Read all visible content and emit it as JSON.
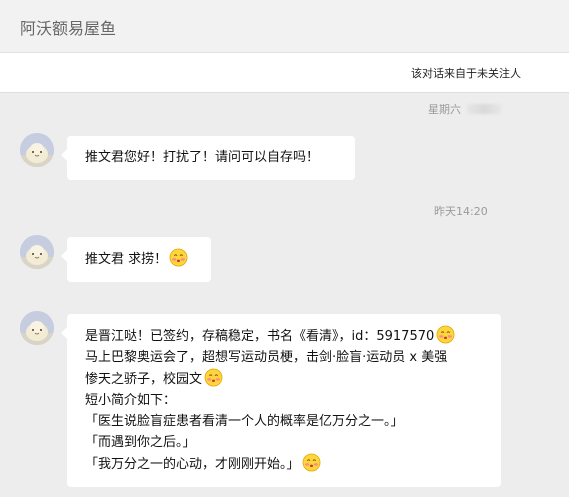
{
  "window": {
    "title": "阿沃额易屋鱼"
  },
  "notice": {
    "text": "该对话来自于未关注人"
  },
  "timestamps": {
    "first": "星期六",
    "second": "昨天14:20"
  },
  "messages": [
    {
      "lines": [
        "推文君您好！打扰了！请问可以自存吗！"
      ]
    },
    {
      "lines": [
        "推文君 求捞！"
      ]
    },
    {
      "lines": [
        "是晋江哒！已签约，存稿稳定，书名《看清》，id：5917570",
        "马上巴黎奥运会了，超想写运动员梗，击剑·脸盲·运动员 x 美强",
        "惨天之骄子，校园文",
        "短小简介如下：",
        "「医生说脸盲症患者看清一个人的概率是亿万分之一。」",
        "「而遇到你之后。」",
        "「我万分之一的心动，才刚刚开始。」"
      ]
    }
  ],
  "icons": {
    "emoji": "shy-blush-emoji-icon",
    "avatar": "cream-bun-avatar"
  }
}
